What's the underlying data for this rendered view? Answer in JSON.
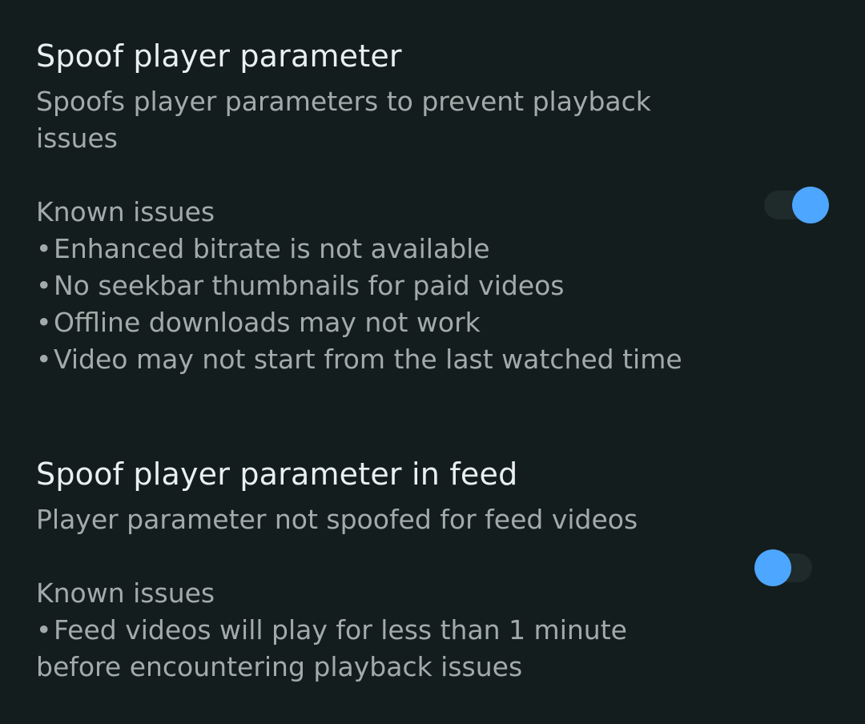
{
  "colors": {
    "background": "#141d1d",
    "title_text": "#e9f0ef",
    "summary_text": "#a3abaa",
    "switch_thumb": "#4da6ff",
    "switch_track": "#1f2a2a"
  },
  "preferences": [
    {
      "title": "Spoof player parameter",
      "summary_lines": [
        "Spoofs player parameters to prevent playback",
        "issues"
      ],
      "issues_heading": "Known issues",
      "issues": [
        "Enhanced bitrate is not available",
        "No seekbar thumbnails for paid videos",
        "Offline downloads may not work",
        "Video may not start from the last watched time"
      ],
      "switch_on": true
    },
    {
      "title": "Spoof player parameter in feed",
      "summary_lines": [
        "Player parameter not spoofed for feed videos"
      ],
      "issues_heading": "Known issues",
      "issues": [
        "Feed videos will play for less than 1 minute"
      ],
      "issues_continuation": "before encountering playback issues",
      "switch_on": false
    }
  ],
  "bullet_glyph": "•"
}
